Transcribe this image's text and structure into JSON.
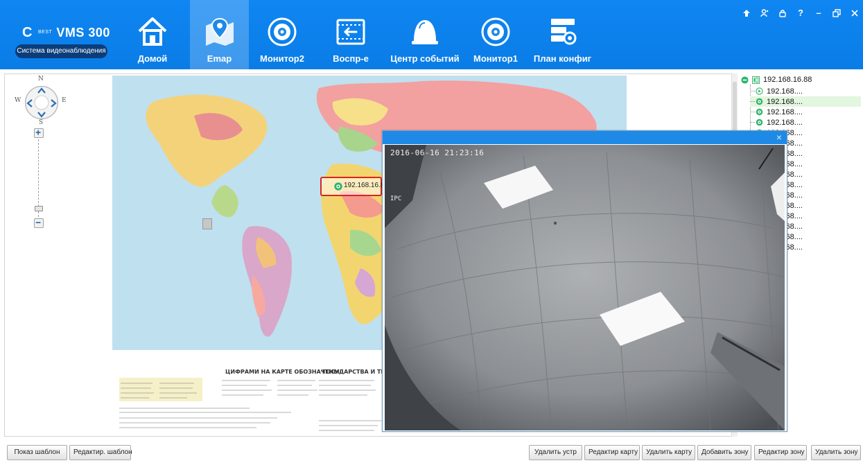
{
  "logo": {
    "brand": "VMS 300",
    "best": "BEST",
    "subtitle": "Система видеонаблюдения"
  },
  "nav": {
    "items": [
      {
        "label": "Домой",
        "icon": "home-icon"
      },
      {
        "label": "Emap",
        "icon": "map-pin-icon",
        "active": true
      },
      {
        "label": "Монитор2",
        "icon": "camera-lens-icon"
      },
      {
        "label": "Воспр-е",
        "icon": "playback-icon"
      },
      {
        "label": "Центр событий",
        "icon": "alarm-bell-icon"
      },
      {
        "label": "Монитор1",
        "icon": "camera-lens-icon"
      },
      {
        "label": "План конфиг",
        "icon": "config-icon"
      }
    ]
  },
  "window_controls": [
    "pin-icon",
    "user-icon",
    "lock-icon",
    "help-icon",
    "minimize-icon",
    "restore-icon",
    "close-icon"
  ],
  "map": {
    "compass": {
      "n": "N",
      "s": "S",
      "w": "W",
      "e": "E"
    },
    "marker_label": "192.168.16.88"
  },
  "tree": {
    "root": "192.168.16.88",
    "children": [
      {
        "label": "192.168....",
        "icon": "play-icon"
      },
      {
        "label": "192.168....",
        "icon": "camera-icon",
        "selected": true
      },
      {
        "label": "192.168....",
        "icon": "camera-icon"
      },
      {
        "label": "192.168....",
        "icon": "camera-icon"
      },
      {
        "label": "192.168....",
        "icon": "camera-icon"
      },
      {
        "label": "192.168....",
        "icon": "camera-icon"
      },
      {
        "label": "192.168....",
        "icon": "camera-icon"
      },
      {
        "label": "192.168....",
        "icon": "camera-icon"
      },
      {
        "label": "192.168....",
        "icon": "camera-icon"
      },
      {
        "label": "192.168....",
        "icon": "camera-icon"
      },
      {
        "label": "192.168....",
        "icon": "camera-icon"
      },
      {
        "label": "192.168....",
        "icon": "camera-icon"
      },
      {
        "label": "192.168....",
        "icon": "camera-icon"
      },
      {
        "label": "192.168....",
        "icon": "camera-icon"
      },
      {
        "label": "192.168....",
        "icon": "camera-icon"
      },
      {
        "label": "192.168....",
        "icon": "camera-icon"
      }
    ]
  },
  "video": {
    "timestamp": "2016-06-16 21:23:16",
    "channel": "IPC",
    "close": "×"
  },
  "buttons": {
    "show_template": "Показ шаблон",
    "edit_template": "Редактир. шаблон",
    "delete_device": "Удалить устр",
    "edit_map": "Редактир карту",
    "delete_map": "Удалить карту",
    "add_zone": "Добавить зону",
    "edit_zone": "Редактир зону",
    "delete_zone": "Удалить зону"
  },
  "colors": {
    "header": "#0a7ce6",
    "accent_green": "#2db36b",
    "marker_border": "#d9261c"
  }
}
